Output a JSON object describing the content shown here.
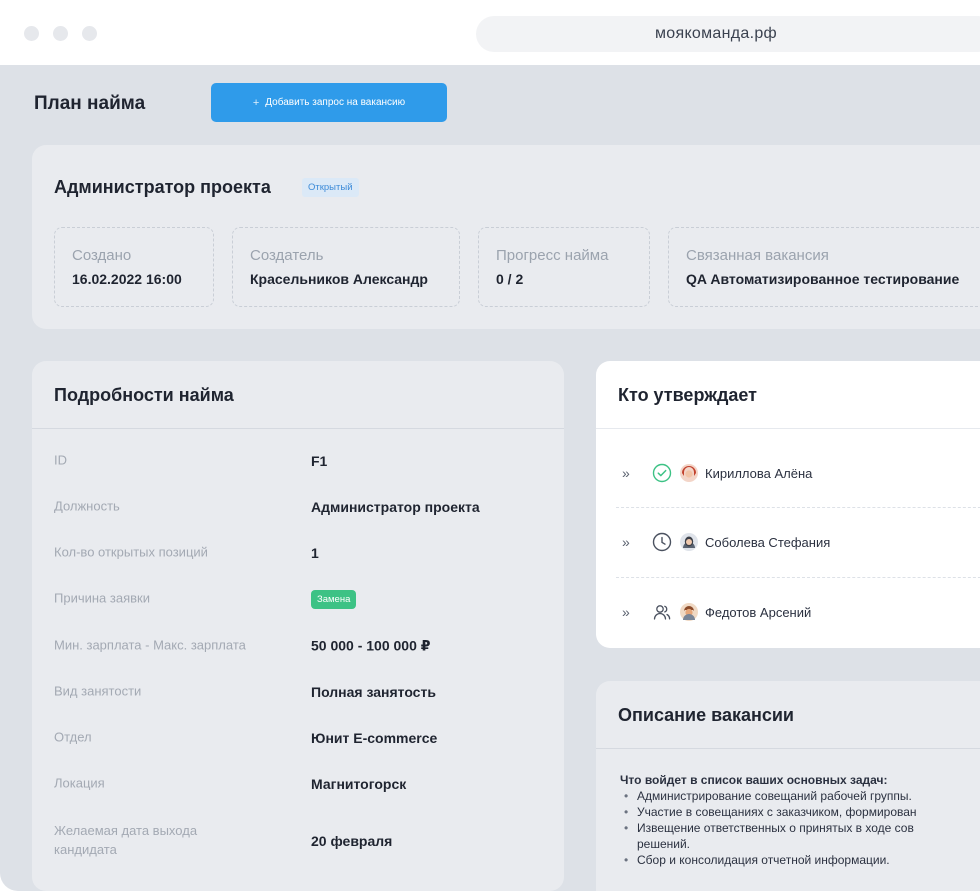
{
  "browser": {
    "url": "моякоманда.рф"
  },
  "header": {
    "title": "План найма",
    "add_button": "Добавить запрос на вакансию",
    "add_icon": "+"
  },
  "summary": {
    "title": "Администратор проекта",
    "status": "Открытый",
    "stats": [
      {
        "label": "Создано",
        "value": "16.02.2022 16:00"
      },
      {
        "label": "Создатель",
        "value": "Красельников Александр"
      },
      {
        "label": "Прогресс найма",
        "value": "0 / 2"
      },
      {
        "label": "Связанная вакансия",
        "value": "QA Автоматизированное тестирование"
      }
    ]
  },
  "details": {
    "title": "Подробности найма",
    "rows": [
      {
        "key": "ID",
        "value": "F1"
      },
      {
        "key": "Должность",
        "value": "Администратор проекта"
      },
      {
        "key": "Кол-во открытых позиций",
        "value": "1"
      },
      {
        "key": "Причина заявки",
        "value": "Замена"
      },
      {
        "key": "Мин. зарплата - Макс. зарплата",
        "value": "50 000 - 100 000 ₽"
      },
      {
        "key": "Вид занятости",
        "value": "Полная занятость"
      },
      {
        "key": "Отдел",
        "value": "Юнит E-commerce"
      },
      {
        "key": "Локация",
        "value": "Магнитогорск"
      },
      {
        "key": "Желаемая дата выхода кандидата",
        "value": "20 февраля"
      }
    ]
  },
  "approvers": {
    "title": "Кто утверждает",
    "items": [
      {
        "name": "Кириллова Алёна",
        "status_icon": "check-circle-icon",
        "chevron": "»"
      },
      {
        "name": "Соболева Стефания",
        "status_icon": "clock-icon",
        "chevron": "»"
      },
      {
        "name": "Федотов Арсений",
        "status_icon": "users-icon",
        "chevron": "»"
      }
    ]
  },
  "description": {
    "title": "Описание вакансии",
    "heading": "Что войдет в список ваших основных задач:",
    "items": [
      "Администрирование совещаний рабочей группы.",
      "Участие в совещаниях с заказчиком, формирован",
      "Извещение ответственных о принятых в ходе сов",
      "решений.",
      "Сбор и консолидация отчетной информации."
    ]
  },
  "colors": {
    "accent": "#2f9bea",
    "success": "#3dc285",
    "badge_bg": "#dbe9f7",
    "badge_text": "#3d8bd8"
  }
}
